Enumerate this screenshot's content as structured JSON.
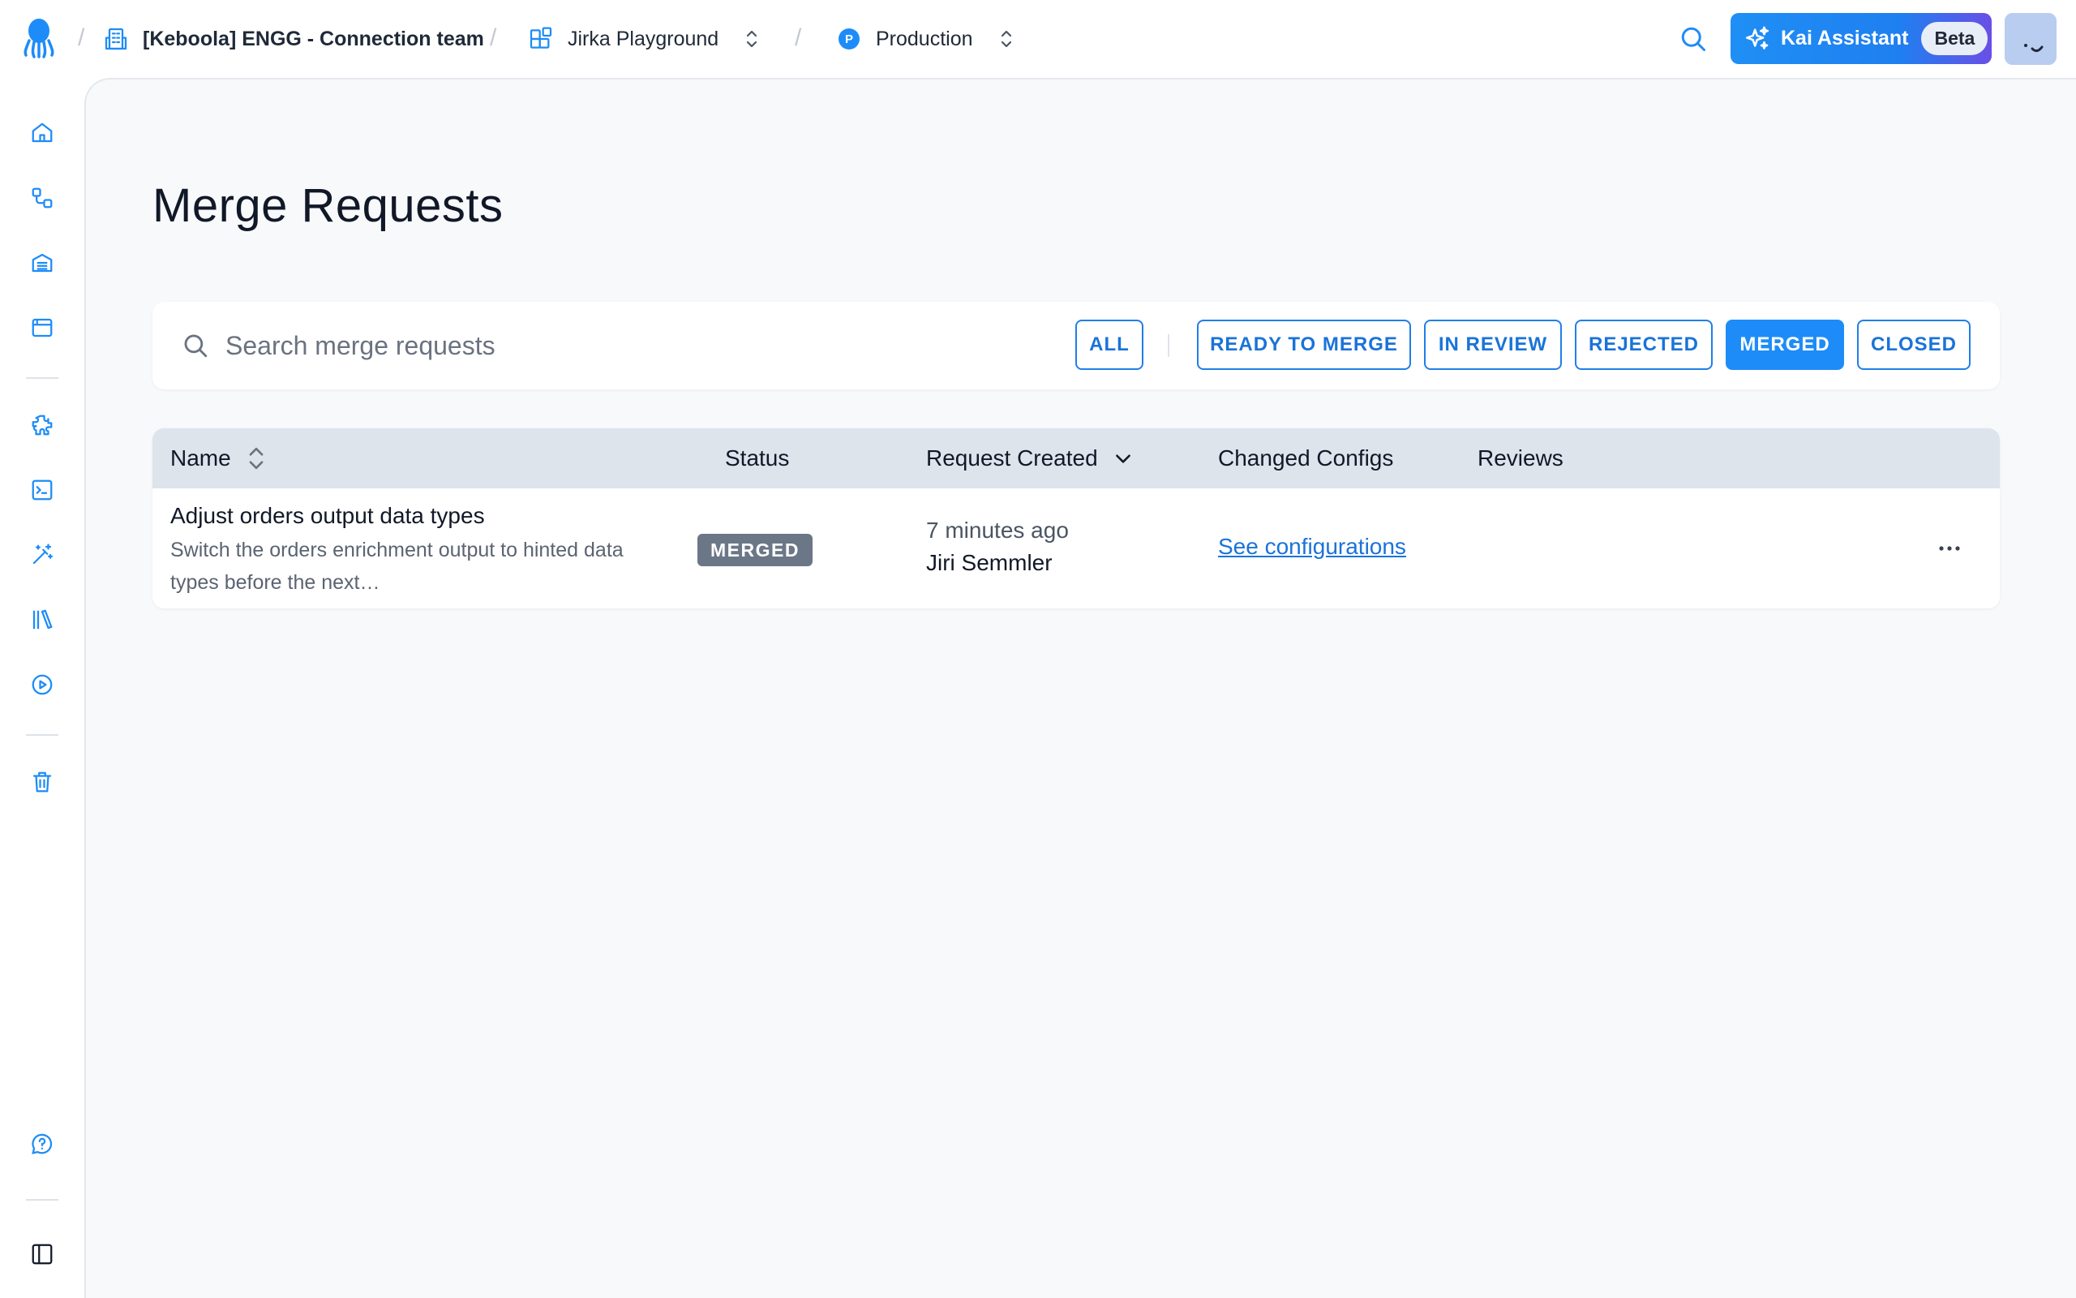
{
  "breadcrumbs": {
    "organization": "[Keboola] ENGG - Connection team",
    "project": "Jirka Playground",
    "branch": "Production",
    "branch_badge": "P",
    "separator": "/"
  },
  "assistant": {
    "label": "Kai Assistant",
    "badge": "Beta"
  },
  "page": {
    "title": "Merge Requests"
  },
  "search": {
    "placeholder": "Search merge requests",
    "value": ""
  },
  "filters": [
    {
      "label": "ALL",
      "active": false
    },
    {
      "label": "READY TO MERGE",
      "active": false
    },
    {
      "label": "IN REVIEW",
      "active": false
    },
    {
      "label": "REJECTED",
      "active": false
    },
    {
      "label": "MERGED",
      "active": true
    },
    {
      "label": "CLOSED",
      "active": false
    }
  ],
  "table": {
    "columns": [
      "Name",
      "Status",
      "Request Created",
      "Changed Configs",
      "Reviews"
    ],
    "rows": [
      {
        "name": "Adjust orders output data types",
        "description": "Switch the orders enrichment output to hinted data types before the next…",
        "status": "MERGED",
        "created": "7 minutes ago",
        "author": "Jiri Semmler",
        "changed_configs": "See configurations",
        "reviews": ""
      }
    ]
  },
  "colors": {
    "accent": "#1d8cf8",
    "link": "#1a73d9",
    "status_merged": "#6b7787",
    "header_bg": "#dee4ec",
    "page_bg": "#f8f9fb"
  }
}
